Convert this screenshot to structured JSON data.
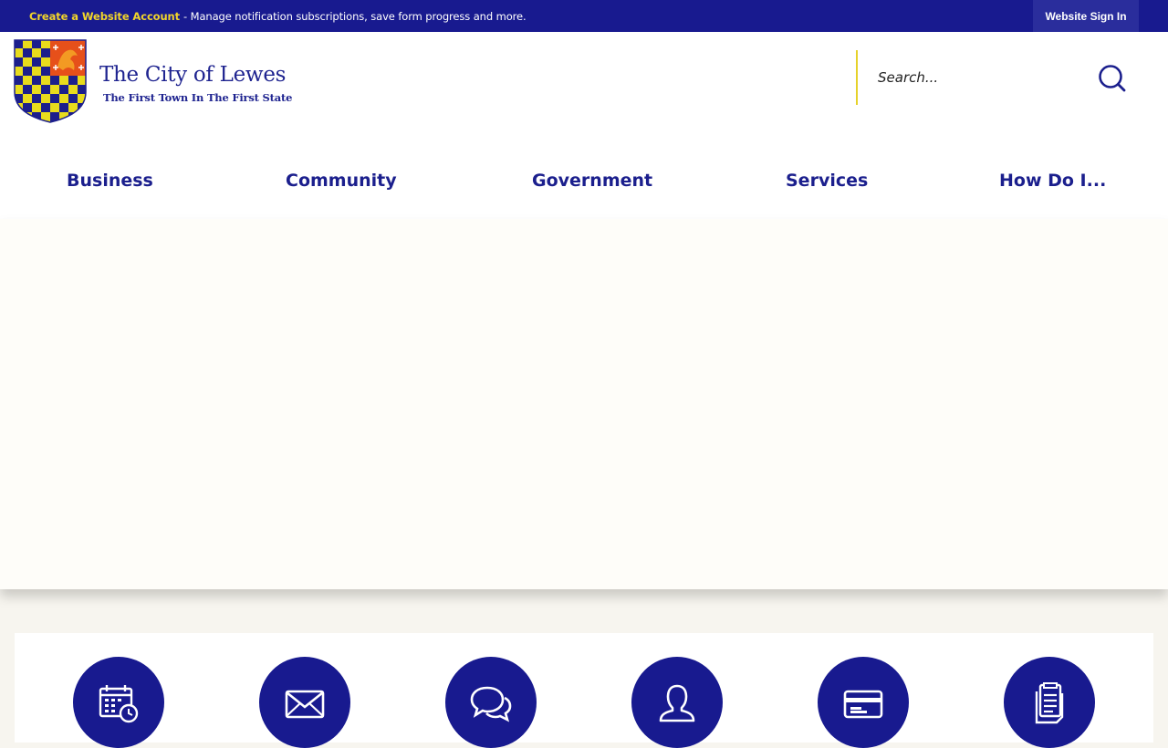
{
  "topbar": {
    "account_link": "Create a Website Account",
    "message": "- Manage notification subscriptions, save form progress and more.",
    "signin": "Website Sign In"
  },
  "logo": {
    "title": "The City of Lewes",
    "tagline": "The First Town In The First State"
  },
  "search": {
    "placeholder": "Search..."
  },
  "nav": {
    "items": [
      {
        "label": "Business"
      },
      {
        "label": "Community"
      },
      {
        "label": "Government"
      },
      {
        "label": "Services"
      },
      {
        "label": "How Do I..."
      }
    ]
  },
  "quick_links": [
    {
      "icon": "calendar-clock-icon"
    },
    {
      "icon": "envelope-icon"
    },
    {
      "icon": "chat-bubbles-icon"
    },
    {
      "icon": "person-icon"
    },
    {
      "icon": "payment-card-icon"
    },
    {
      "icon": "documents-icon"
    }
  ],
  "colors": {
    "brand_navy": "#181a8f",
    "accent_yellow": "#f2d52a",
    "nav_text": "#1b1f8d"
  }
}
